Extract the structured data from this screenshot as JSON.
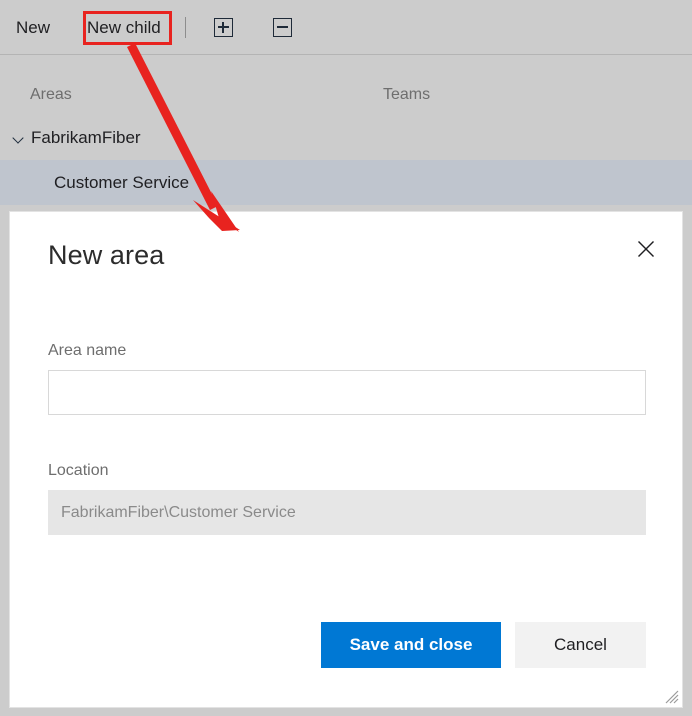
{
  "toolbar": {
    "new_label": "New",
    "new_child_label": "New child",
    "expand_all_icon": "plus-box-icon",
    "collapse_all_icon": "minus-box-icon"
  },
  "tree": {
    "columns": {
      "areas": "Areas",
      "teams": "Teams"
    },
    "rows": [
      {
        "label": "FabrikamFiber",
        "expanded": true,
        "selected": false
      },
      {
        "label": "Customer Service",
        "expanded": false,
        "selected": true
      }
    ]
  },
  "annotation": {
    "highlight_target": "New child",
    "arrow_color": "#e8231f"
  },
  "dialog": {
    "title": "New area",
    "close_icon": "close-icon",
    "fields": {
      "area_name": {
        "label": "Area name",
        "value": "",
        "placeholder": ""
      },
      "location": {
        "label": "Location",
        "value": "FabrikamFiber\\Customer Service",
        "readonly": true
      }
    },
    "buttons": {
      "save": "Save and close",
      "cancel": "Cancel"
    },
    "resize_grip_icon": "resize-grip-icon"
  },
  "colors": {
    "accent": "#0078d4",
    "annotation": "#e8231f",
    "chrome": "#cccccc",
    "selected_row": "#bfc5ce"
  }
}
